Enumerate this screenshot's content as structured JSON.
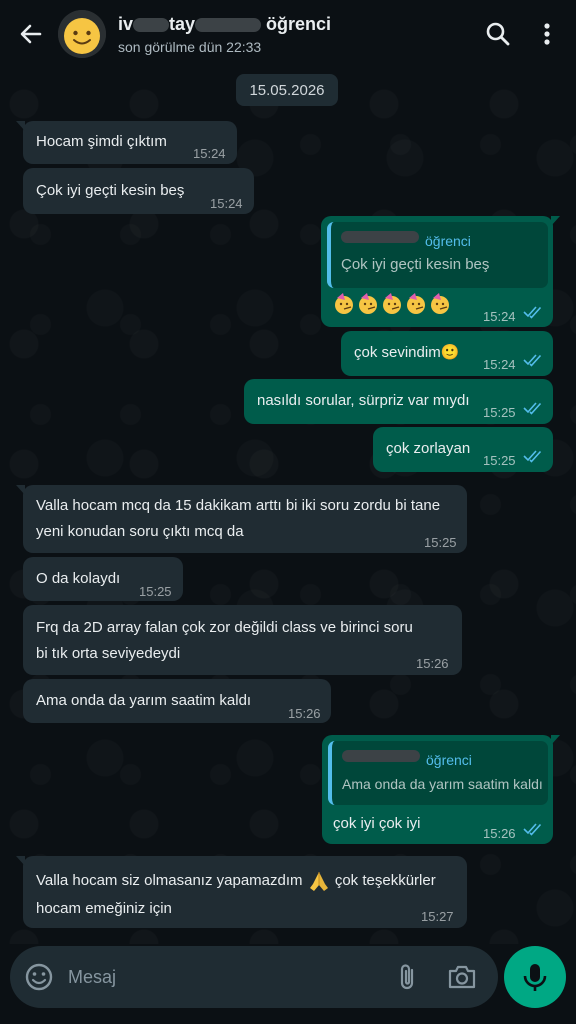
{
  "header": {
    "name_part1": "iv",
    "name_part2": "tay",
    "name_part3": "öğrenci",
    "status": "son görülme dün 22:33"
  },
  "chat": {
    "date": "15.05.2026",
    "messages": [
      {
        "dir": "in",
        "text": "Hocam şimdi çıktım",
        "time": "15:24"
      },
      {
        "dir": "in",
        "text": "Çok iyi geçti kesin beş",
        "time": "15:24"
      },
      {
        "dir": "out",
        "quote_author": "öğrenci",
        "quote_text": "Çok iyi geçti kesin beş",
        "text": "🥳🥳🥳🥳🥳",
        "time": "15:24"
      },
      {
        "dir": "out",
        "text": "çok sevindim🙂",
        "time": "15:24"
      },
      {
        "dir": "out",
        "text": "nasıldı sorular, sürpriz var mıydı",
        "time": "15:25"
      },
      {
        "dir": "out",
        "text": "çok zorlayan",
        "time": "15:25"
      },
      {
        "dir": "in",
        "line1": "Valla hocam mcq da 15 dakikam arttı bi iki soru zordu bi tane",
        "line2": "yeni konudan soru çıktı mcq da",
        "time": "15:25"
      },
      {
        "dir": "in",
        "text": "O da kolaydı",
        "time": "15:25"
      },
      {
        "dir": "in",
        "line1": "Frq da 2D array falan çok zor değildi class ve birinci soru",
        "line2": "bi tık orta seviyedeydi",
        "time": "15:26"
      },
      {
        "dir": "in",
        "text": "Ama onda da yarım saatim kaldı",
        "time": "15:26"
      },
      {
        "dir": "out",
        "quote_author": "öğrenci",
        "quote_text": "Ama onda da yarım saatim kaldı",
        "text": "çok iyi çok iyi",
        "time": "15:26"
      },
      {
        "dir": "in",
        "line1a": "Valla hocam siz olmasanız yapamazdım",
        "line1b": "çok teşekkürler",
        "line2": "hocam emeğiniz için",
        "time": "15:27"
      }
    ]
  },
  "composer": {
    "placeholder": "Mesaj"
  },
  "colors": {
    "incoming": "#202c33",
    "outgoing": "#005c4b",
    "accent": "#00a884",
    "quote_accent": "#53bdeb",
    "read_ticks": "#53bdeb"
  },
  "icons": [
    "back-arrow-icon",
    "avatar-emoji-icon",
    "search-icon",
    "more-vert-icon",
    "double-check-icon",
    "emoji-icon",
    "attach-icon",
    "camera-icon",
    "mic-icon"
  ]
}
